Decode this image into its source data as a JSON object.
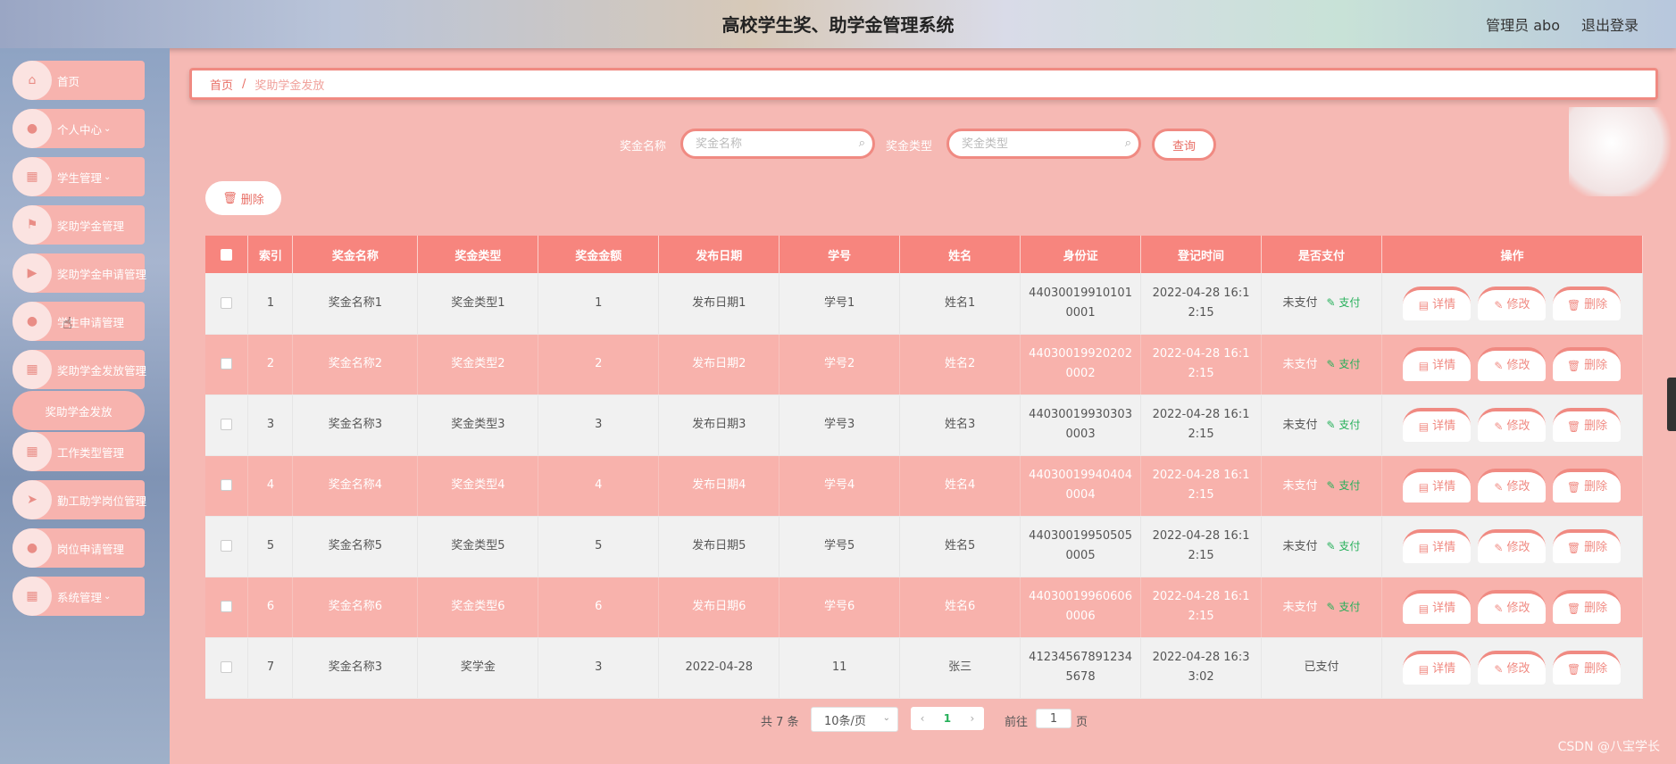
{
  "header": {
    "title": "高校学生奖、助学金管理系统",
    "user": "管理员 abo",
    "logout": "退出登录"
  },
  "sidebar": {
    "items": [
      {
        "label": "首页",
        "icon": "home-icon",
        "arrow": ""
      },
      {
        "label": "个人中心",
        "icon": "user-icon",
        "arrow": "⌄"
      },
      {
        "label": "学生管理",
        "icon": "grid-icon",
        "arrow": "⌄"
      },
      {
        "label": "奖助学金管理",
        "icon": "flag-icon",
        "arrow": ""
      },
      {
        "label": "奖助学金申请管理",
        "icon": "video-icon",
        "arrow": ""
      },
      {
        "label": "学生申请管理",
        "icon": "user-icon",
        "arrow": ""
      },
      {
        "label": "奖助学金发放管理",
        "icon": "grid-icon",
        "arrow": ""
      },
      {
        "label": "奖助学金发放",
        "icon": "",
        "arrow": ""
      },
      {
        "label": "工作类型管理",
        "icon": "grid-icon",
        "arrow": ""
      },
      {
        "label": "勤工助学岗位管理",
        "icon": "send-icon",
        "arrow": ""
      },
      {
        "label": "岗位申请管理",
        "icon": "user-icon",
        "arrow": ""
      },
      {
        "label": "系统管理",
        "icon": "grid-icon",
        "arrow": "⌄"
      }
    ]
  },
  "breadcrumb": {
    "home": "首页",
    "sep": "/",
    "current": "奖助学金发放"
  },
  "search": {
    "name_label": "奖金名称",
    "name_placeholder": "奖金名称",
    "type_label": "奖金类型",
    "type_placeholder": "奖金类型",
    "query": "查询"
  },
  "toolbar": {
    "delete": "删除"
  },
  "table": {
    "headers": [
      "索引",
      "奖金名称",
      "奖金类型",
      "奖金金额",
      "发布日期",
      "学号",
      "姓名",
      "身份证",
      "登记时间",
      "是否支付",
      "操作"
    ],
    "rows": [
      {
        "idx": "1",
        "name": "奖金名称1",
        "type": "奖金类型1",
        "amount": "1",
        "date": "发布日期1",
        "sno": "学号1",
        "sname": "姓名1",
        "id_a": "44030019910101",
        "id_b": "0001",
        "time_a": "2022-04-28 16:1",
        "time_b": "2:15",
        "paid": "未支付",
        "pay": "支付"
      },
      {
        "idx": "2",
        "name": "奖金名称2",
        "type": "奖金类型2",
        "amount": "2",
        "date": "发布日期2",
        "sno": "学号2",
        "sname": "姓名2",
        "id_a": "44030019920202",
        "id_b": "0002",
        "time_a": "2022-04-28 16:1",
        "time_b": "2:15",
        "paid": "未支付",
        "pay": "支付"
      },
      {
        "idx": "3",
        "name": "奖金名称3",
        "type": "奖金类型3",
        "amount": "3",
        "date": "发布日期3",
        "sno": "学号3",
        "sname": "姓名3",
        "id_a": "44030019930303",
        "id_b": "0003",
        "time_a": "2022-04-28 16:1",
        "time_b": "2:15",
        "paid": "未支付",
        "pay": "支付"
      },
      {
        "idx": "4",
        "name": "奖金名称4",
        "type": "奖金类型4",
        "amount": "4",
        "date": "发布日期4",
        "sno": "学号4",
        "sname": "姓名4",
        "id_a": "44030019940404",
        "id_b": "0004",
        "time_a": "2022-04-28 16:1",
        "time_b": "2:15",
        "paid": "未支付",
        "pay": "支付"
      },
      {
        "idx": "5",
        "name": "奖金名称5",
        "type": "奖金类型5",
        "amount": "5",
        "date": "发布日期5",
        "sno": "学号5",
        "sname": "姓名5",
        "id_a": "44030019950505",
        "id_b": "0005",
        "time_a": "2022-04-28 16:1",
        "time_b": "2:15",
        "paid": "未支付",
        "pay": "支付"
      },
      {
        "idx": "6",
        "name": "奖金名称6",
        "type": "奖金类型6",
        "amount": "6",
        "date": "发布日期6",
        "sno": "学号6",
        "sname": "姓名6",
        "id_a": "44030019960606",
        "id_b": "0006",
        "time_a": "2022-04-28 16:1",
        "time_b": "2:15",
        "paid": "未支付",
        "pay": "支付"
      },
      {
        "idx": "7",
        "name": "奖金名称3",
        "type": "奖学金",
        "amount": "3",
        "date": "2022-04-28",
        "sno": "11",
        "sname": "张三",
        "id_a": "41234567891234",
        "id_b": "5678",
        "time_a": "2022-04-28 16:3",
        "time_b": "3:02",
        "paid": "已支付",
        "pay": ""
      }
    ],
    "ops": {
      "detail": "详情",
      "edit": "修改",
      "delete": "删除"
    }
  },
  "pager": {
    "total": "共 7 条",
    "size": "10条/页",
    "prev": "‹",
    "current": "1",
    "next": "›",
    "goto": "前往",
    "page_value": "1",
    "page_unit": "页"
  },
  "watermark": "CSDN @八宝学长",
  "colors": {
    "accent": "#f08a82",
    "header_bg": "#f7857e",
    "pink_row": "#f8b2ac",
    "pay_green": "#26b05a"
  }
}
